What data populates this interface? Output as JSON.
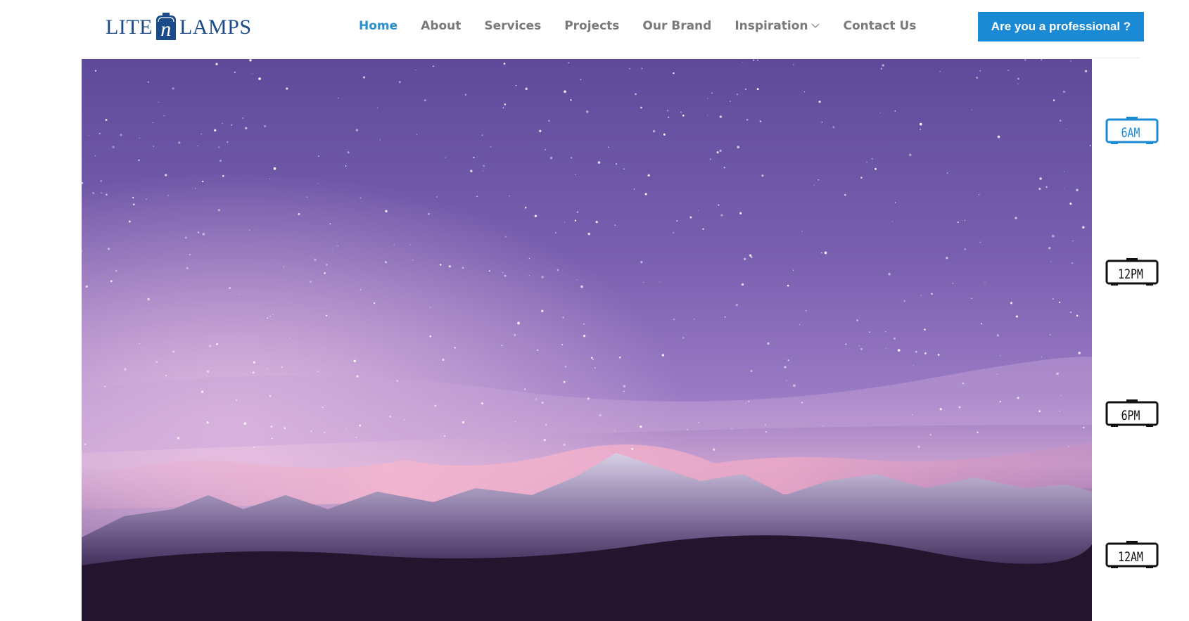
{
  "brand": {
    "left": "LITE",
    "middle": "n",
    "right": "LAMPS",
    "color": "#1b4a8a"
  },
  "nav": {
    "items": [
      {
        "label": "Home",
        "active": true
      },
      {
        "label": "About",
        "active": false
      },
      {
        "label": "Services",
        "active": false
      },
      {
        "label": "Projects",
        "active": false
      },
      {
        "label": "Our Brand",
        "active": false
      },
      {
        "label": "Inspiration",
        "active": false,
        "has_dropdown": true
      },
      {
        "label": "Contact Us",
        "active": false
      }
    ],
    "active_color": "#2a8fd0",
    "text_color": "#7a7a7a"
  },
  "cta": {
    "label": "Are you a professional ?",
    "color": "#1a8ad4"
  },
  "time_selector": {
    "options": [
      {
        "label": "6AM",
        "active": true
      },
      {
        "label": "12PM",
        "active": false
      },
      {
        "label": "6PM",
        "active": false
      },
      {
        "label": "12AM",
        "active": false
      }
    ],
    "active_color": "#1a8ad4",
    "inactive_color": "#111111"
  },
  "hero": {
    "scene": "starry night sky over snow-capped mountain ridge",
    "sky_color": "#7a5fb0",
    "ground_color": "#24142e"
  }
}
